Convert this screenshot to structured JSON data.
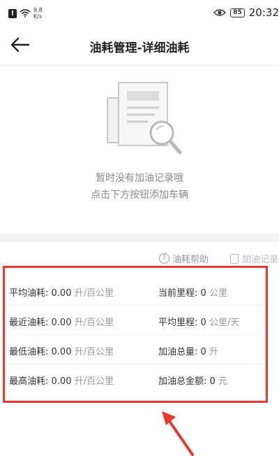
{
  "status_bar": {
    "alert": "!",
    "speed_value": "9.8",
    "speed_unit": "K/s",
    "battery": "85",
    "time": "20:32"
  },
  "header": {
    "title": "油耗管理-详细油耗"
  },
  "empty_state": {
    "line1": "暂时没有加油记录哦",
    "line2": "点击下方按钮添加车辆"
  },
  "toolbar": {
    "help_icon": "?",
    "help_label": "油耗帮助",
    "record_label": "加油记录"
  },
  "stats": [
    {
      "left": {
        "label": "平均油耗:",
        "value": "0.00",
        "unit": "升/百公里"
      },
      "right": {
        "label": "当前里程:",
        "value": "0",
        "unit": "公里"
      }
    },
    {
      "left": {
        "label": "最近油耗:",
        "value": "0.00",
        "unit": "升/百公里"
      },
      "right": {
        "label": "平均里程:",
        "value": "0",
        "unit": "公里/天"
      }
    },
    {
      "left": {
        "label": "最低油耗:",
        "value": "0.00",
        "unit": "升/百公里"
      },
      "right": {
        "label": "加油总量:",
        "value": "0",
        "unit": "升"
      }
    },
    {
      "left": {
        "label": "最高油耗:",
        "value": "0.00",
        "unit": "升/百公里"
      },
      "right": {
        "label": "加油总金额:",
        "value": "0",
        "unit": "元"
      }
    }
  ],
  "colors": {
    "annotation_red": "#e8392e",
    "muted_text": "#999999"
  }
}
